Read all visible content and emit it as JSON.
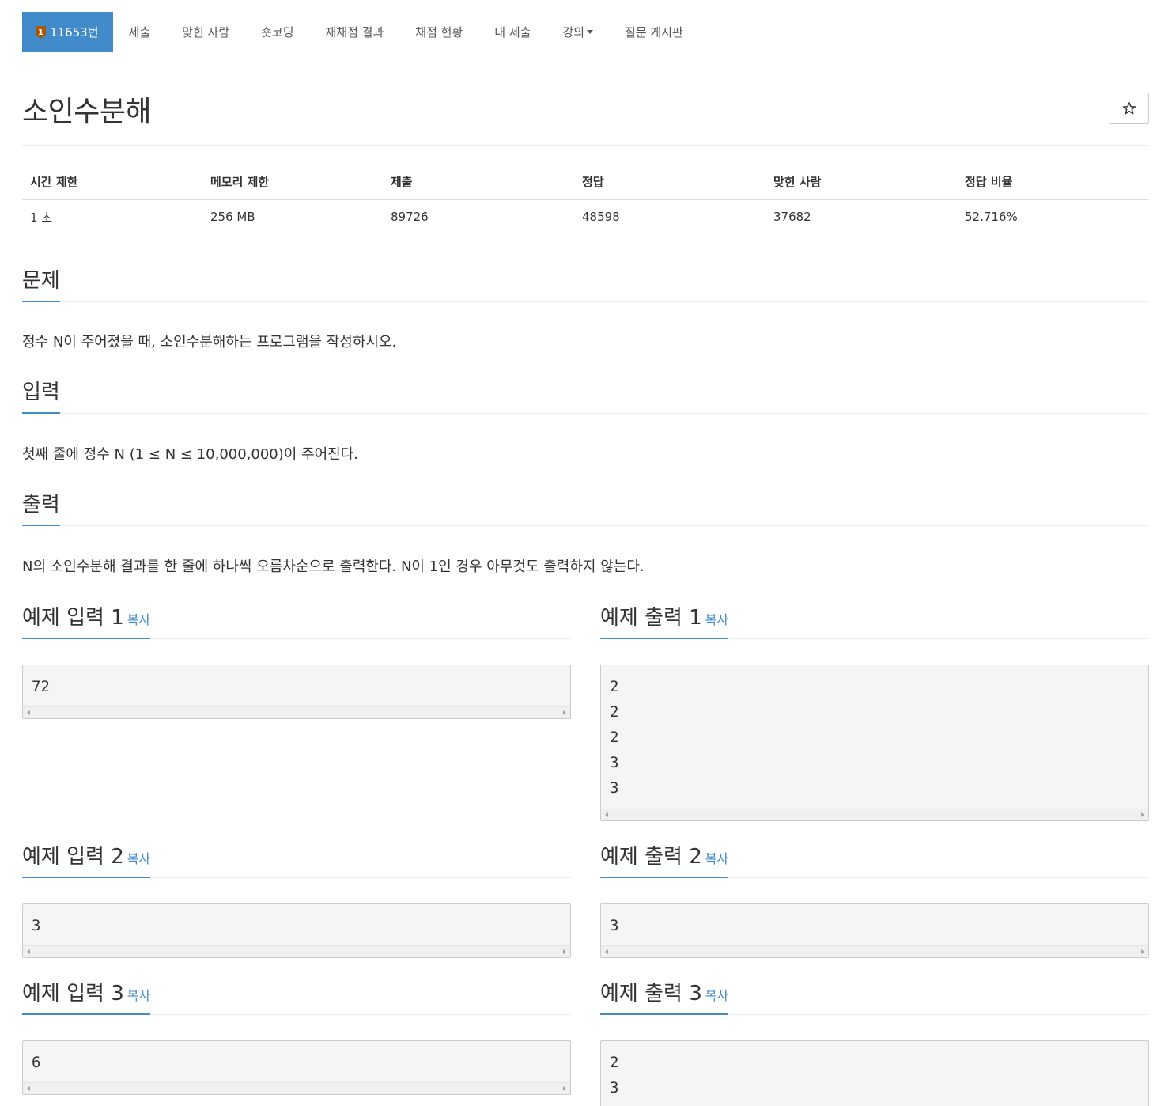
{
  "nav": {
    "problem_id": "11653번",
    "tier_level": "1",
    "items": [
      "제출",
      "맞힌 사람",
      "숏코딩",
      "재채점 결과",
      "채점 현황",
      "내 제출",
      "강의",
      "질문 게시판"
    ]
  },
  "title": "소인수분해",
  "info": {
    "headers": [
      "시간 제한",
      "메모리 제한",
      "제출",
      "정답",
      "맞힌 사람",
      "정답 비율"
    ],
    "values": [
      "1 초",
      "256 MB",
      "89726",
      "48598",
      "37682",
      "52.716%"
    ]
  },
  "sections": {
    "problem": {
      "title": "문제",
      "text": "정수 N이 주어졌을 때, 소인수분해하는 프로그램을 작성하시오."
    },
    "input": {
      "title": "입력",
      "text": "첫째 줄에 정수 N (1 ≤ N ≤ 10,000,000)이 주어진다."
    },
    "output": {
      "title": "출력",
      "text": "N의 소인수분해 결과를 한 줄에 하나씩 오름차순으로 출력한다. N이 1인 경우 아무것도 출력하지 않는다."
    }
  },
  "copy_label": "복사",
  "examples": [
    {
      "input_title": "예제 입력 1",
      "output_title": "예제 출력 1",
      "input": [
        "72"
      ],
      "output": [
        "2",
        "2",
        "2",
        "3",
        "3"
      ]
    },
    {
      "input_title": "예제 입력 2",
      "output_title": "예제 출력 2",
      "input": [
        "3"
      ],
      "output": [
        "3"
      ]
    },
    {
      "input_title": "예제 입력 3",
      "output_title": "예제 출력 3",
      "input": [
        "6"
      ],
      "output": [
        "2",
        "3"
      ]
    }
  ],
  "colors": {
    "accent": "#428bca",
    "text": "#333333",
    "pre_bg": "#f5f5f5"
  }
}
